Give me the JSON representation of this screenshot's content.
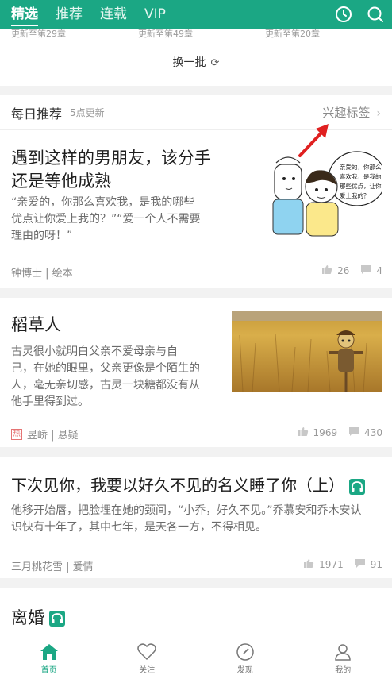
{
  "top_nav": {
    "tabs": [
      {
        "label": "精选",
        "active": true
      },
      {
        "label": "推荐",
        "active": false
      },
      {
        "label": "连载",
        "active": false
      },
      {
        "label": "VIP",
        "active": false
      }
    ],
    "icons": [
      "history-icon",
      "search-icon"
    ]
  },
  "prev_updates": [
    "更新至第29章",
    "更新至第49章",
    "更新至第20章"
  ],
  "refresh": {
    "label": "换一批",
    "icon": "refresh-icon"
  },
  "daily": {
    "title": "每日推荐",
    "subtitle": "5点更新",
    "tags_link": "兴趣标签"
  },
  "cards": [
    {
      "title_lines": [
        "遇到这样的男朋友，该分手",
        "还是等他成熟"
      ],
      "desc_lines": [
        "“亲爱的，你那么喜欢我，是我的哪些",
        "优点让你爱上我的？”“爱一个人不需要",
        "理由的呀！”"
      ],
      "meta": "钟博士 | 绘本",
      "likes": "26",
      "comments": "4",
      "bubble_lines": [
        "亲爱的，你那么",
        "喜欢我，是我的",
        "那些优点，让你",
        "爱上我的？"
      ]
    },
    {
      "title_lines": [
        "稻草人"
      ],
      "desc_lines": [
        "古灵很小就明白父亲不爱母亲与自",
        "己，在她的眼里，父亲更像是个陌生的",
        "人，毫无亲切感，古灵一块糖都没有从",
        "他手里得到过。"
      ],
      "hot_badge": "热",
      "meta": "昱峤 | 悬疑",
      "likes": "1969",
      "comments": "430"
    },
    {
      "title_lines": [
        "下次见你，我要以好久不见的名义睡了你（上）"
      ],
      "desc_lines": [
        "他移开始唇，把脸埋在她的颈间，“小乔，好久不见。”乔慕安和乔木安认",
        "识快有十年了，其中七年，是天各一方，不得相见。"
      ],
      "meta": "三月桃花雪 | 爱情",
      "likes": "1971",
      "comments": "91"
    },
    {
      "title_lines": [
        "离婚"
      ]
    }
  ],
  "bottom_nav": [
    {
      "label": "首页",
      "icon": "home-icon",
      "active": true
    },
    {
      "label": "关注",
      "icon": "heart-icon",
      "active": false
    },
    {
      "label": "发现",
      "icon": "compass-icon",
      "active": false
    },
    {
      "label": "我的",
      "icon": "profile-icon",
      "active": false
    }
  ],
  "colors": {
    "accent": "#1ba784",
    "annotation_arrow": "#e02020"
  }
}
